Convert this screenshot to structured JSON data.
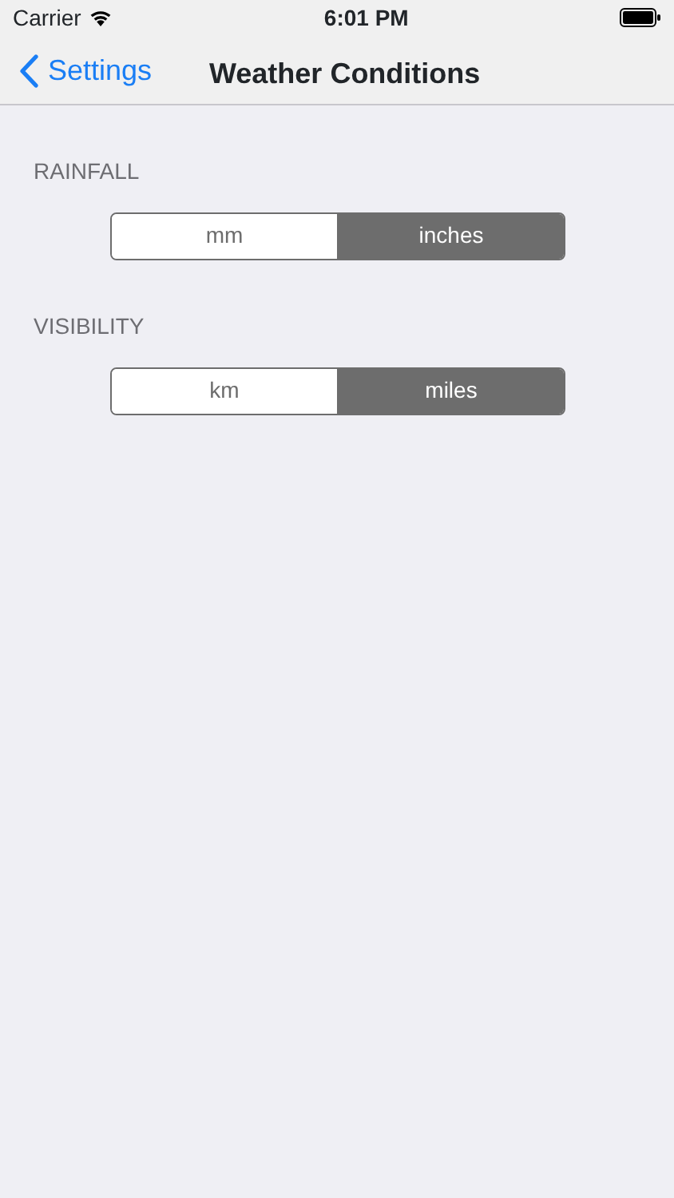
{
  "status_bar": {
    "carrier": "Carrier",
    "time": "6:01 PM"
  },
  "nav_bar": {
    "back": "Settings",
    "title": "Weather Conditions"
  },
  "sections": [
    {
      "header": "RAINFALL",
      "options": [
        {
          "label": "mm",
          "selected": false
        },
        {
          "label": "inches",
          "selected": true
        }
      ]
    },
    {
      "header": "VISIBILITY",
      "options": [
        {
          "label": "km",
          "selected": false
        },
        {
          "label": "miles",
          "selected": true
        }
      ]
    }
  ]
}
